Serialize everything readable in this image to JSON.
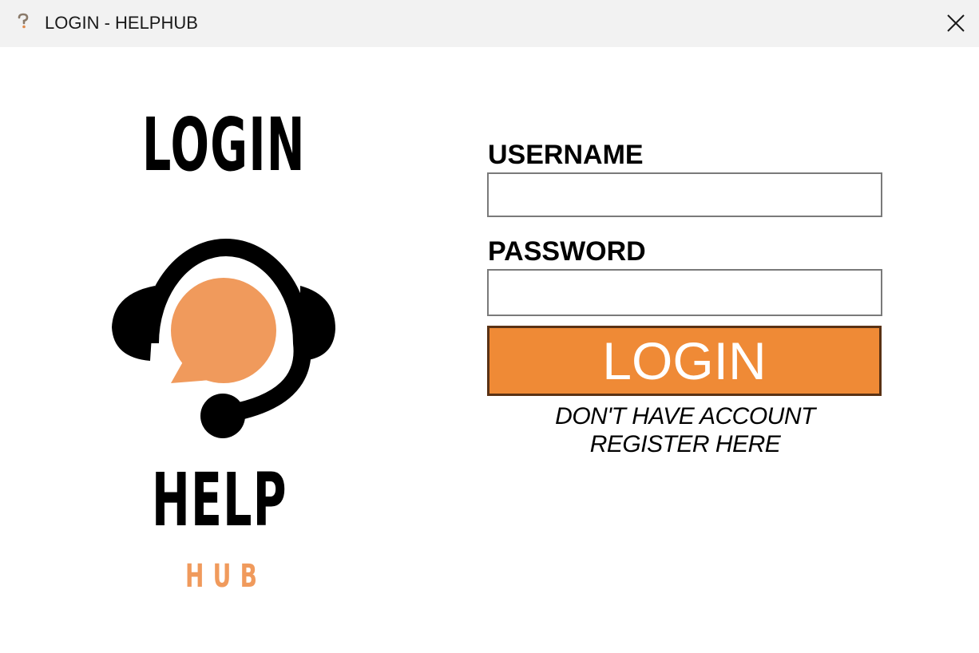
{
  "window": {
    "title": "LOGIN - HELPHUB",
    "icon": "question-mark-app-icon",
    "close_icon": "close-icon"
  },
  "branding": {
    "heading": "LOGIN",
    "logo_icon": "headset-chat-bubble-icon",
    "name_primary": "HELP",
    "name_secondary": "HUB",
    "accent_color": "#f09a5c"
  },
  "form": {
    "username_label": "USERNAME",
    "username_value": "",
    "password_label": "PASSWORD",
    "password_value": "",
    "login_button_label": "LOGIN",
    "login_button_color": "#ef8a36",
    "register_line1": "DON'T HAVE ACCOUNT",
    "register_line2": "REGISTER HERE"
  }
}
